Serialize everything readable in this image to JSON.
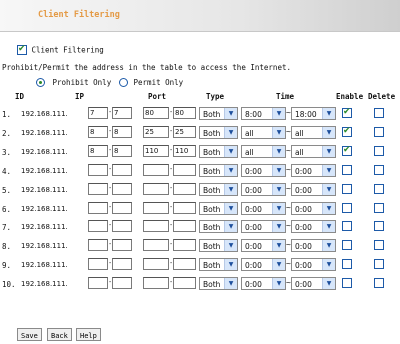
{
  "page": {
    "title": "Client Filtering"
  },
  "filter": {
    "enable_label": "Client Filtering",
    "enabled": true,
    "description": "Prohibit/Permit the address in the table to access the Internet.",
    "mode_prohibit_label": "Prohibit Only",
    "mode_permit_label": "Permit Only",
    "mode_selected": "prohibit"
  },
  "table": {
    "headers": {
      "id": "ID",
      "ip": "IP",
      "port": "Port",
      "type": "Type",
      "time": "Time",
      "enable": "Enable",
      "delete": "Delete"
    },
    "ip_prefix": "192.168.111.",
    "rows": [
      {
        "id": "1.",
        "ip_start": "7",
        "ip_end": "7",
        "port_start": "80",
        "port_end": "80",
        "type": "Both",
        "time_start": "8:00",
        "time_end": "18:00",
        "enable": true,
        "delete": false
      },
      {
        "id": "2.",
        "ip_start": "8",
        "ip_end": "8",
        "port_start": "25",
        "port_end": "25",
        "type": "Both",
        "time_start": "all",
        "time_end": "all",
        "enable": true,
        "delete": false
      },
      {
        "id": "3.",
        "ip_start": "8",
        "ip_end": "8",
        "port_start": "110",
        "port_end": "110",
        "type": "Both",
        "time_start": "all",
        "time_end": "all",
        "enable": true,
        "delete": false
      },
      {
        "id": "4.",
        "ip_start": "",
        "ip_end": "",
        "port_start": "",
        "port_end": "",
        "type": "Both",
        "time_start": "0:00",
        "time_end": "0:00",
        "enable": false,
        "delete": false
      },
      {
        "id": "5.",
        "ip_start": "",
        "ip_end": "",
        "port_start": "",
        "port_end": "",
        "type": "Both",
        "time_start": "0:00",
        "time_end": "0:00",
        "enable": false,
        "delete": false
      },
      {
        "id": "6.",
        "ip_start": "",
        "ip_end": "",
        "port_start": "",
        "port_end": "",
        "type": "Both",
        "time_start": "0:00",
        "time_end": "0:00",
        "enable": false,
        "delete": false
      },
      {
        "id": "7.",
        "ip_start": "",
        "ip_end": "",
        "port_start": "",
        "port_end": "",
        "type": "Both",
        "time_start": "0:00",
        "time_end": "0:00",
        "enable": false,
        "delete": false
      },
      {
        "id": "8.",
        "ip_start": "",
        "ip_end": "",
        "port_start": "",
        "port_end": "",
        "type": "Both",
        "time_start": "0:00",
        "time_end": "0:00",
        "enable": false,
        "delete": false
      },
      {
        "id": "9.",
        "ip_start": "",
        "ip_end": "",
        "port_start": "",
        "port_end": "",
        "type": "Both",
        "time_start": "0:00",
        "time_end": "0:00",
        "enable": false,
        "delete": false
      },
      {
        "id": "10.",
        "ip_start": "",
        "ip_end": "",
        "port_start": "",
        "port_end": "",
        "type": "Both",
        "time_start": "0:00",
        "time_end": "0:00",
        "enable": false,
        "delete": false
      }
    ]
  },
  "buttons": {
    "save": "Save",
    "back": "Back",
    "help": "Help"
  },
  "icons": {
    "dropdown": "chevron-down-icon",
    "checkbox_check": "check-icon"
  },
  "colors": {
    "title": "#e49a45",
    "check": "#2a8a2a",
    "control_border": "#1d5aa8",
    "dropdown_arrow_bg": "#d7e6fa"
  }
}
